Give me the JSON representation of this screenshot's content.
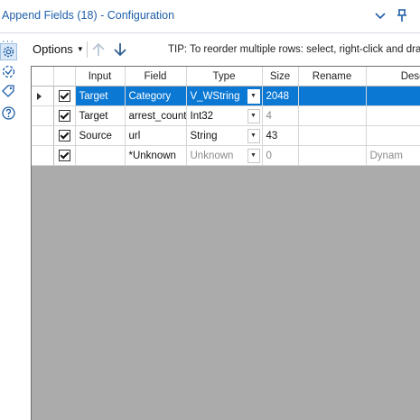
{
  "window": {
    "title": "Append Fields (18) - Configuration"
  },
  "toolbar": {
    "options_label": "Options",
    "tip": "TIP: To reorder multiple rows: select, right-click and dra"
  },
  "grid": {
    "headers": [
      "Input",
      "Field",
      "Type",
      "Size",
      "Rename",
      "Descri"
    ],
    "rows": [
      {
        "checked": true,
        "input": "Target",
        "field": "Category",
        "type": "V_WString",
        "size": "2048",
        "rename": "",
        "description": ""
      },
      {
        "checked": true,
        "input": "Target",
        "field": "arrest_count",
        "type": "Int32",
        "size": "4",
        "rename": "",
        "description": ""
      },
      {
        "checked": true,
        "input": "Source",
        "field": "url",
        "type": "String",
        "size": "43",
        "rename": "",
        "description": ""
      },
      {
        "checked": true,
        "input": "",
        "field": "*Unknown",
        "type": "Unknown",
        "size": "0",
        "rename": "",
        "description": "Dynam"
      }
    ]
  },
  "colors": {
    "accent": "#1f5fa8",
    "selection": "#0b78d4",
    "grid_empty": "#ababab"
  },
  "icons": {
    "titlebar": [
      "chevron-down-icon",
      "pin-icon"
    ],
    "sidebar": [
      "gear-icon",
      "connection-icon",
      "tag-icon",
      "help-icon"
    ],
    "toolbar": [
      "arrow-up-icon",
      "arrow-down-icon"
    ]
  }
}
